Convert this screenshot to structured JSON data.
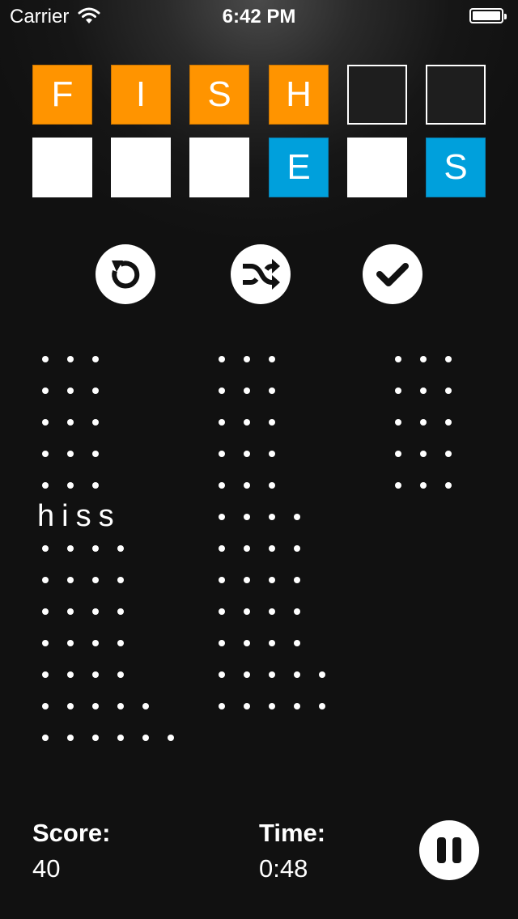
{
  "status_bar": {
    "carrier": "Carrier",
    "time": "6:42 PM",
    "icons": [
      "wifi-icon",
      "battery-icon"
    ]
  },
  "colors": {
    "orange": "#ff9400",
    "blue": "#00a0dc",
    "background": "#111111"
  },
  "answer_row": [
    "F",
    "I",
    "S",
    "H",
    "",
    ""
  ],
  "letter_pool": [
    "",
    "",
    "",
    "E",
    "",
    "S"
  ],
  "controls": [
    "undo-icon",
    "shuffle-icon",
    "check-icon"
  ],
  "word_lists": [
    {
      "words": [
        {
          "length": 3,
          "text": ""
        },
        {
          "length": 3,
          "text": ""
        },
        {
          "length": 3,
          "text": ""
        },
        {
          "length": 3,
          "text": ""
        },
        {
          "length": 3,
          "text": ""
        },
        {
          "length": 4,
          "text": "hiss"
        },
        {
          "length": 4,
          "text": ""
        },
        {
          "length": 4,
          "text": ""
        },
        {
          "length": 4,
          "text": ""
        },
        {
          "length": 4,
          "text": ""
        },
        {
          "length": 4,
          "text": ""
        },
        {
          "length": 5,
          "text": ""
        },
        {
          "length": 6,
          "text": ""
        }
      ]
    },
    {
      "words": [
        {
          "length": 3,
          "text": ""
        },
        {
          "length": 3,
          "text": ""
        },
        {
          "length": 3,
          "text": ""
        },
        {
          "length": 3,
          "text": ""
        },
        {
          "length": 3,
          "text": ""
        },
        {
          "length": 4,
          "text": ""
        },
        {
          "length": 4,
          "text": ""
        },
        {
          "length": 4,
          "text": ""
        },
        {
          "length": 4,
          "text": ""
        },
        {
          "length": 4,
          "text": ""
        },
        {
          "length": 5,
          "text": ""
        },
        {
          "length": 5,
          "text": ""
        }
      ]
    },
    {
      "words": [
        {
          "length": 3,
          "text": ""
        },
        {
          "length": 3,
          "text": ""
        },
        {
          "length": 3,
          "text": ""
        },
        {
          "length": 3,
          "text": ""
        },
        {
          "length": 3,
          "text": ""
        }
      ]
    }
  ],
  "footer": {
    "score_label": "Score:",
    "score_value": "40",
    "time_label": "Time:",
    "time_value": "0:48",
    "pause_icon": "pause-icon"
  }
}
